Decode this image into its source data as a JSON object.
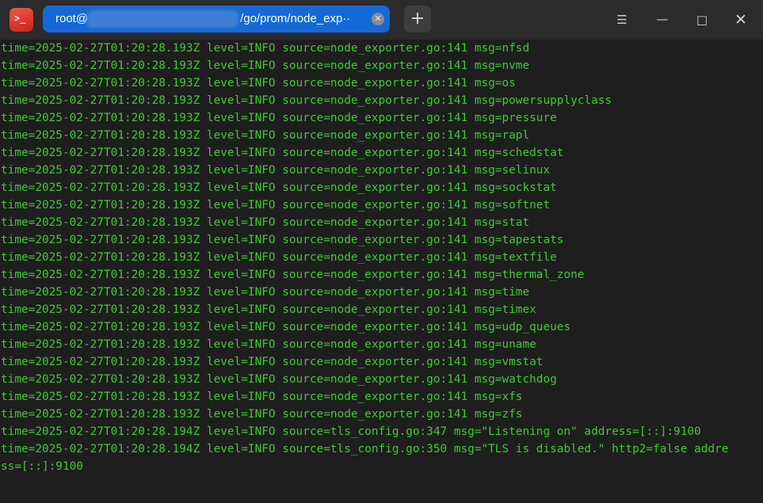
{
  "window": {
    "tab_title_prefix": "root@",
    "tab_title_suffix": "/go/prom/node_exp··",
    "tab_close_glyph": "✕",
    "new_tab_glyph": "+",
    "app_icon_glyph": ">_",
    "menu_glyph": "☰",
    "minimize_glyph": "—",
    "maximize_glyph": "□",
    "close_glyph": "✕",
    "accent_color": "#1469d9",
    "text_color": "#3dcc2f",
    "icons": [
      "terminal-app-icon",
      "close-icon",
      "plus-icon",
      "menu-icon",
      "minimize-icon",
      "maximize-icon",
      "close-icon"
    ]
  },
  "terminal": {
    "lines": [
      "time=2025-02-27T01:20:28.193Z level=INFO source=node_exporter.go:141 msg=nfsd",
      "time=2025-02-27T01:20:28.193Z level=INFO source=node_exporter.go:141 msg=nvme",
      "time=2025-02-27T01:20:28.193Z level=INFO source=node_exporter.go:141 msg=os",
      "time=2025-02-27T01:20:28.193Z level=INFO source=node_exporter.go:141 msg=powersupplyclass",
      "time=2025-02-27T01:20:28.193Z level=INFO source=node_exporter.go:141 msg=pressure",
      "time=2025-02-27T01:20:28.193Z level=INFO source=node_exporter.go:141 msg=rapl",
      "time=2025-02-27T01:20:28.193Z level=INFO source=node_exporter.go:141 msg=schedstat",
      "time=2025-02-27T01:20:28.193Z level=INFO source=node_exporter.go:141 msg=selinux",
      "time=2025-02-27T01:20:28.193Z level=INFO source=node_exporter.go:141 msg=sockstat",
      "time=2025-02-27T01:20:28.193Z level=INFO source=node_exporter.go:141 msg=softnet",
      "time=2025-02-27T01:20:28.193Z level=INFO source=node_exporter.go:141 msg=stat",
      "time=2025-02-27T01:20:28.193Z level=INFO source=node_exporter.go:141 msg=tapestats",
      "time=2025-02-27T01:20:28.193Z level=INFO source=node_exporter.go:141 msg=textfile",
      "time=2025-02-27T01:20:28.193Z level=INFO source=node_exporter.go:141 msg=thermal_zone",
      "time=2025-02-27T01:20:28.193Z level=INFO source=node_exporter.go:141 msg=time",
      "time=2025-02-27T01:20:28.193Z level=INFO source=node_exporter.go:141 msg=timex",
      "time=2025-02-27T01:20:28.193Z level=INFO source=node_exporter.go:141 msg=udp_queues",
      "time=2025-02-27T01:20:28.193Z level=INFO source=node_exporter.go:141 msg=uname",
      "time=2025-02-27T01:20:28.193Z level=INFO source=node_exporter.go:141 msg=vmstat",
      "time=2025-02-27T01:20:28.193Z level=INFO source=node_exporter.go:141 msg=watchdog",
      "time=2025-02-27T01:20:28.193Z level=INFO source=node_exporter.go:141 msg=xfs",
      "time=2025-02-27T01:20:28.193Z level=INFO source=node_exporter.go:141 msg=zfs",
      "time=2025-02-27T01:20:28.194Z level=INFO source=tls_config.go:347 msg=\"Listening on\" address=[::]:9100",
      "time=2025-02-27T01:20:28.194Z level=INFO source=tls_config.go:350 msg=\"TLS is disabled.\" http2=false addre",
      "ss=[::]:9100"
    ]
  }
}
